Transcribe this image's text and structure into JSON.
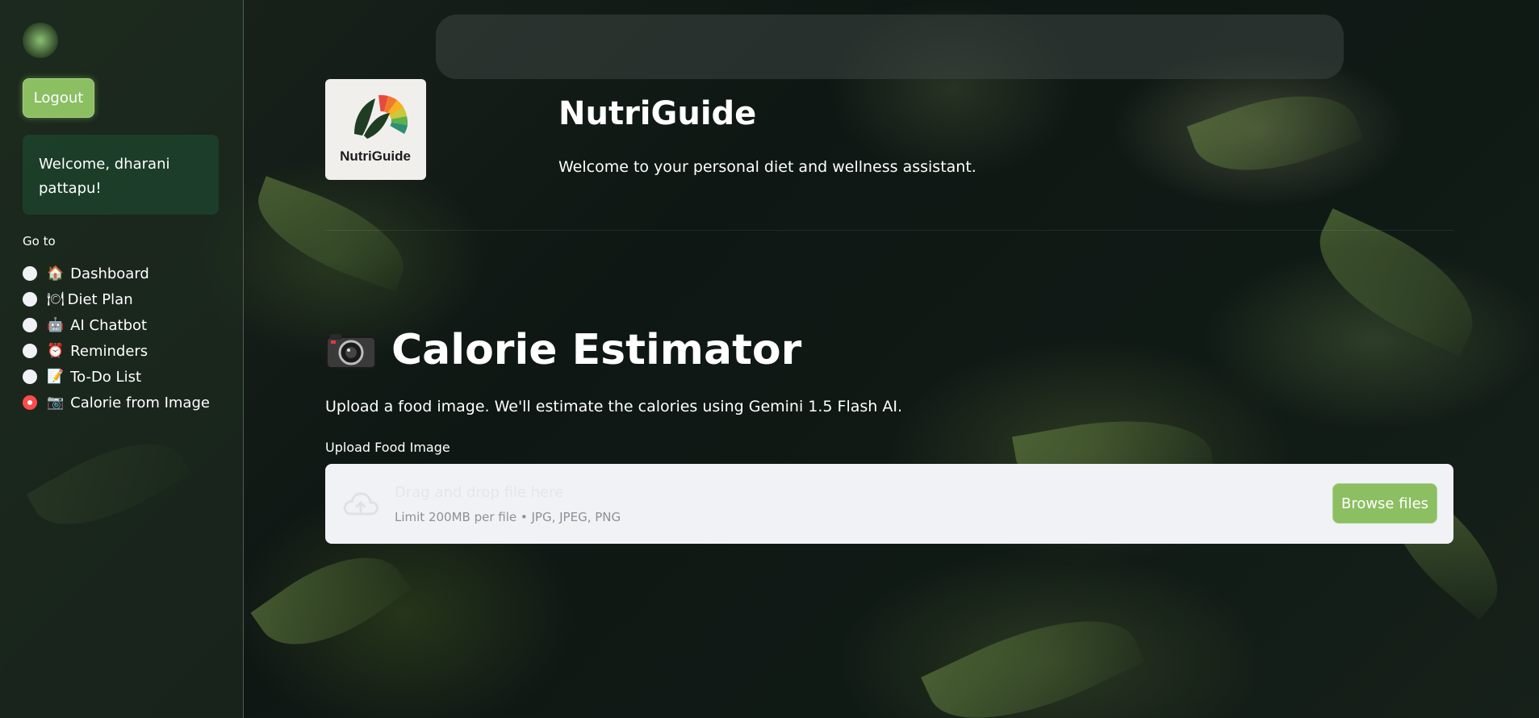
{
  "sidebar": {
    "logout_label": "Logout",
    "welcome_text": "Welcome, dharani pattapu!",
    "goto_label": "Go to",
    "nav_items": [
      {
        "emoji": "🏠",
        "label": "Dashboard",
        "selected": false
      },
      {
        "emoji": "🍽",
        "label": "Diet Plan",
        "selected": false
      },
      {
        "emoji": "🤖",
        "label": "AI Chatbot",
        "selected": false
      },
      {
        "emoji": "⏰",
        "label": "Reminders",
        "selected": false
      },
      {
        "emoji": "📝",
        "label": "To-Do List",
        "selected": false
      },
      {
        "emoji": "📷",
        "label": "Calorie from Image",
        "selected": true
      }
    ]
  },
  "header": {
    "logo_text": "NutriGuide",
    "title": "NutriGuide",
    "subtitle": "Welcome to your personal diet and wellness assistant."
  },
  "main": {
    "section_title": "Calorie Estimator",
    "section_description": "Upload a food image. We'll estimate the calories using Gemini 1.5 Flash AI.",
    "upload_label": "Upload Food Image",
    "dropzone_main_text": "Drag and drop file here",
    "dropzone_limits_text": "Limit 200MB per file • JPG, JPEG, PNG",
    "browse_label": "Browse files"
  },
  "colors": {
    "accent_green": "#8bbf62",
    "radio_selected": "#ff4b4b",
    "dropzone_bg": "#f0f2f6"
  }
}
